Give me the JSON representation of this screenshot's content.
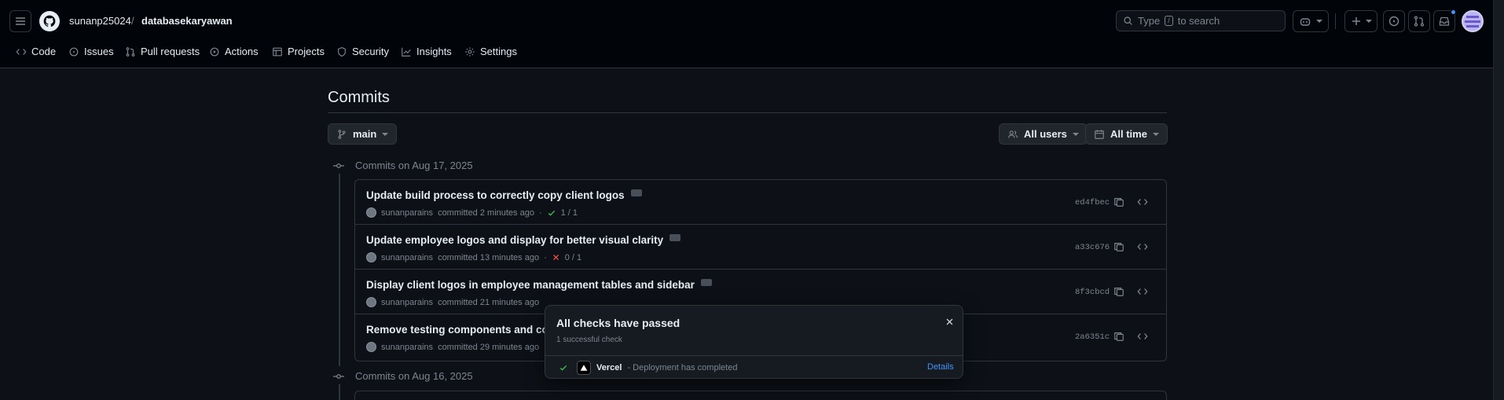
{
  "header": {
    "owner": "sunanp25024",
    "separator": "/",
    "repo": "databasekaryawan",
    "search_prefix": "Type",
    "search_key": "/",
    "search_suffix": "to search"
  },
  "tabs": [
    {
      "label": "Code",
      "icon": "code-icon"
    },
    {
      "label": "Issues",
      "icon": "issue-icon"
    },
    {
      "label": "Pull requests",
      "icon": "pull-request-icon"
    },
    {
      "label": "Actions",
      "icon": "play-icon"
    },
    {
      "label": "Projects",
      "icon": "table-icon"
    },
    {
      "label": "Security",
      "icon": "shield-icon"
    },
    {
      "label": "Insights",
      "icon": "graph-icon"
    },
    {
      "label": "Settings",
      "icon": "gear-icon"
    }
  ],
  "page": {
    "title": "Commits",
    "branch": "main",
    "users_filter": "All users",
    "time_filter": "All time"
  },
  "groups": [
    {
      "label": "Commits on Aug 17, 2025"
    },
    {
      "label": "Commits on Aug 16, 2025"
    }
  ],
  "commits": [
    {
      "title": "Update build process to correctly copy client logos",
      "author": "sunanparains",
      "when": "committed 2 minutes ago",
      "status": "success",
      "checks": "1 / 1",
      "sha": "ed4fbec"
    },
    {
      "title": "Update employee logos and display for better visual clarity",
      "author": "sunanparains",
      "when": "committed 13 minutes ago",
      "status": "failure",
      "checks": "0 / 1",
      "sha": "a33c676"
    },
    {
      "title": "Display client logos in employee management tables and sidebar",
      "author": "sunanparains",
      "when": "committed 21 minutes ago",
      "status": "none",
      "checks": "",
      "sha": "8f3cbcd"
    },
    {
      "title": "Remove testing components and cons",
      "author": "sunanparains",
      "when": "committed 29 minutes ago",
      "status": "none",
      "checks": "",
      "sha": "2a6351c"
    }
  ],
  "checks_popup": {
    "title": "All checks have passed",
    "subtitle": "1 successful check",
    "app": "Vercel",
    "message": "- Deployment has completed",
    "details_link": "Details"
  },
  "colors": {
    "accent": "#4493f8",
    "success": "#3fb950",
    "danger": "#f85149",
    "background": "#0d1117"
  }
}
